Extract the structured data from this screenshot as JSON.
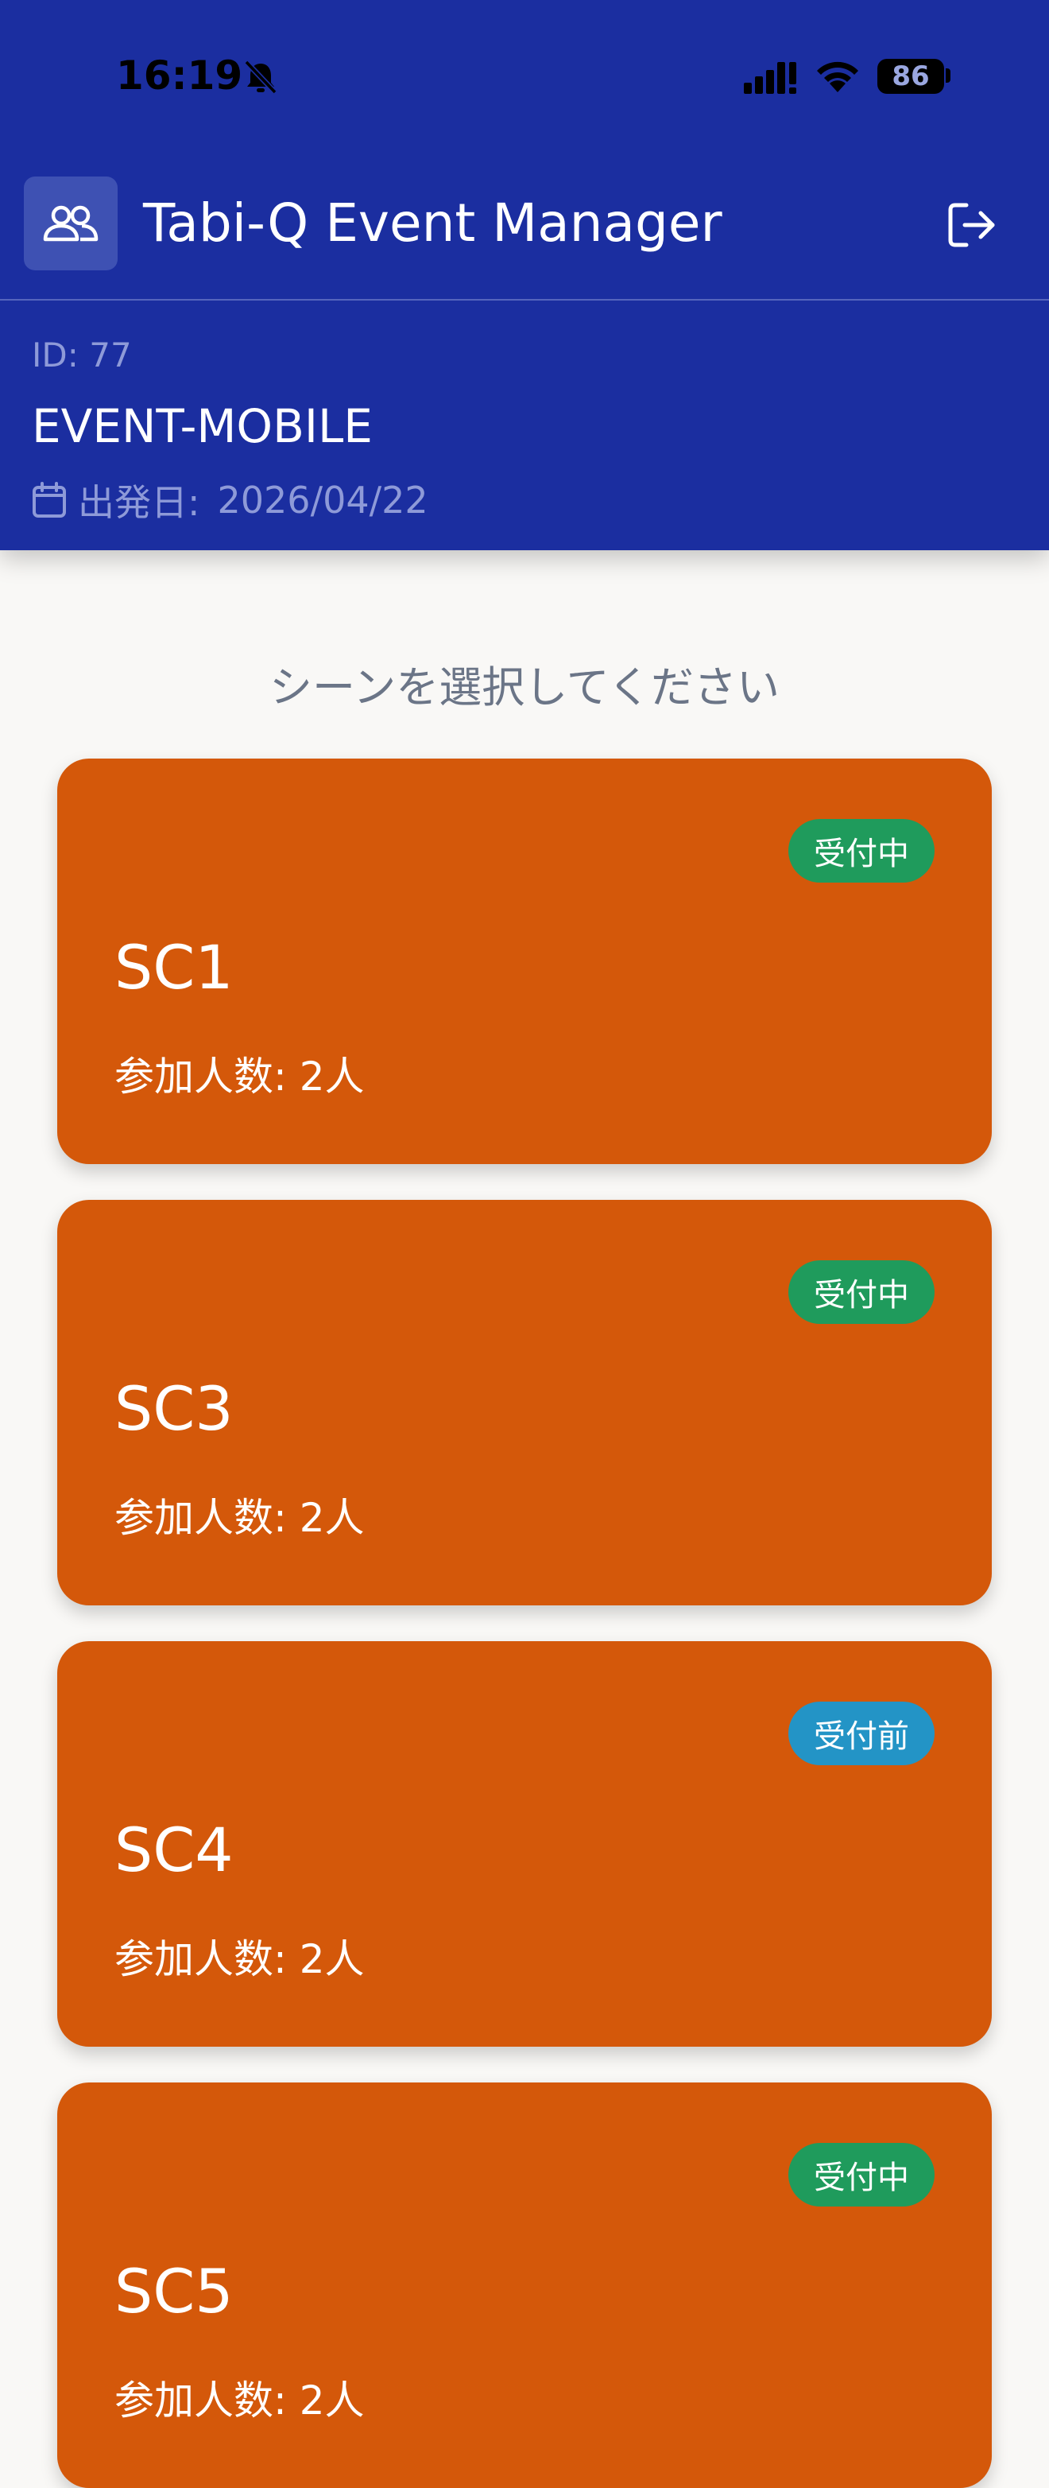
{
  "status_bar": {
    "time": "16:19",
    "battery": "86"
  },
  "app": {
    "title": "Tabi-Q Event Manager"
  },
  "event": {
    "id": "ID: 77",
    "name": "EVENT-MOBILE",
    "date_label": "出発日:",
    "date": "2026/04/22"
  },
  "prompt": "シーンを選択してください",
  "colors": {
    "header": "#1b2ea0",
    "card": "#d4580a",
    "badge_open": "#1f9b5c",
    "badge_before": "#2394c6"
  },
  "scenes": [
    {
      "name": "SC1",
      "count": "参加人数: 2人",
      "status": "受付中",
      "status_color": "#1f9b5c"
    },
    {
      "name": "SC3",
      "count": "参加人数: 2人",
      "status": "受付中",
      "status_color": "#1f9b5c"
    },
    {
      "name": "SC4",
      "count": "参加人数: 2人",
      "status": "受付前",
      "status_color": "#2394c6"
    },
    {
      "name": "SC5",
      "count": "参加人数: 2人",
      "status": "受付中",
      "status_color": "#1f9b5c"
    }
  ]
}
